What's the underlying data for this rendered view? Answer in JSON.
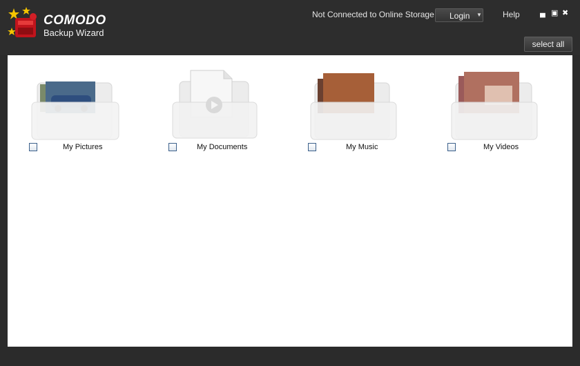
{
  "app": {
    "brand": "COMODO",
    "subtitle": "Backup Wizard"
  },
  "header": {
    "status": "Not Connected to Online Storage",
    "login_label": "Login",
    "help_label": "Help",
    "minimize_glyph": "▄",
    "restore_glyph": "▣",
    "close_glyph": "✖"
  },
  "toolbar": {
    "select_all_label": "select all"
  },
  "folders": [
    {
      "label": "My Pictures",
      "checked": false,
      "icon": "pictures-folder-icon"
    },
    {
      "label": "My Documents",
      "checked": false,
      "icon": "documents-folder-icon"
    },
    {
      "label": "My Music",
      "checked": false,
      "icon": "music-folder-icon"
    },
    {
      "label": "My Videos",
      "checked": false,
      "icon": "videos-folder-icon"
    }
  ]
}
